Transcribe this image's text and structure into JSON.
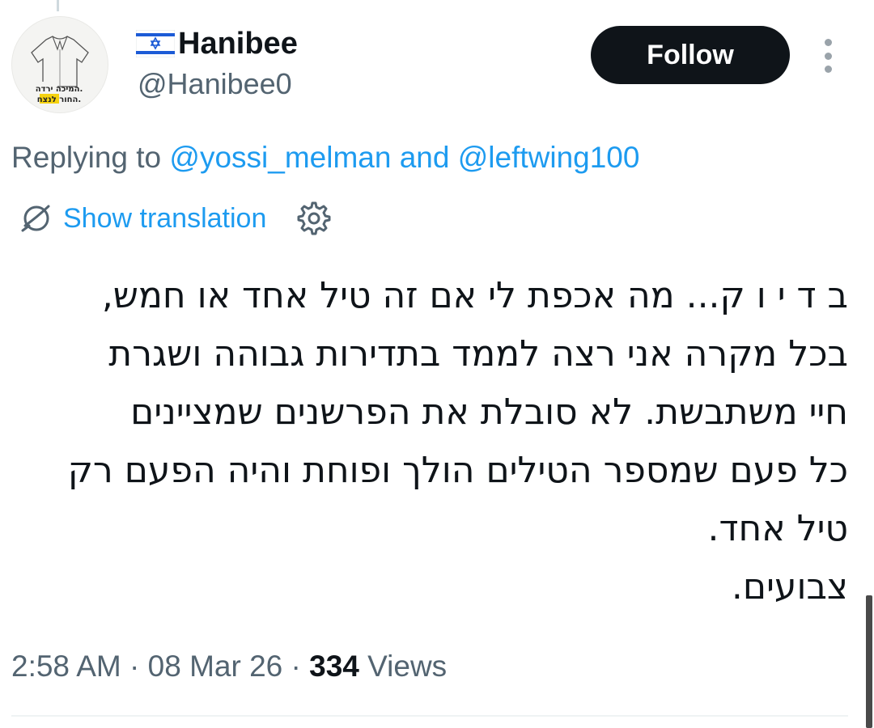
{
  "author": {
    "display_name": "Hanibee",
    "flag": "israel-flag",
    "handle": "@Hanibee0",
    "avatar_caption_line1": "המיכה ירדה.",
    "avatar_caption_line2": "החור לנצח."
  },
  "follow_button": {
    "label": "Follow"
  },
  "more_menu": {
    "icon": "more-vertical-icon"
  },
  "reply_context": {
    "prefix": "Replying to",
    "mention1": "@yossi_melman",
    "conjunction": "and",
    "mention2": "@leftwing100"
  },
  "translation": {
    "label": "Show translation",
    "icon": "globe-icon",
    "settings_icon": "gear-icon"
  },
  "tweet": {
    "text": "ב ד י ו ק... מה אכפת לי אם זה טיל אחד או חמש,\nבכל מקרה אני רצה לממד בתדירות גבוהה ושגרת\nחיי משתבשת. לא סובלת את הפרשנים שמציינים\nכל פעם שמספר הטילים הולך ופוחת והיה הפעם רק\nטיל אחד.\nצבועים."
  },
  "meta": {
    "time": "2:58 AM",
    "separator": "·",
    "date": "08 Mar 26",
    "views_count": "334",
    "views_label": "Views"
  },
  "colors": {
    "link": "#1d9bf0",
    "secondary_text": "#536471",
    "primary_text": "#0f1419",
    "follow_bg": "#0f1419"
  }
}
